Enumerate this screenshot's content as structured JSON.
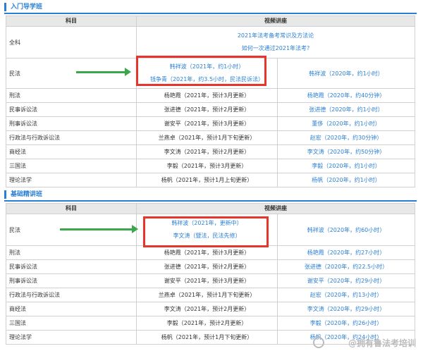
{
  "sections": [
    {
      "title": "入门导学班",
      "headers": {
        "subject": "科目",
        "video": "视频讲座"
      },
      "quanke": {
        "subject": "全科",
        "line1": "2021年法考备考常识及方法论",
        "line2": "如何一次通过2021年法考?"
      },
      "minfa": {
        "subject": "民法",
        "c1": "韩祥波（2021年，约1小时）",
        "c2": "钱争青（2021年，约3.5小时，民法民诉法）",
        "right": "韩祥波（2020年，约1小时）"
      },
      "rows": [
        {
          "subject": "刑法",
          "mid": "杨艳霞（2021年，预计3月更新）",
          "right": "杨艳霞（2020年，约40分钟）"
        },
        {
          "subject": "民事诉讼法",
          "mid": "张进德（2021年，预计2月更新）",
          "right": "张进德（2020年，约1小时）"
        },
        {
          "subject": "刑事诉讼法",
          "mid": "谢安平（2021年，预计3月更新）",
          "right": "董侈（2020年，约1小时）"
        },
        {
          "subject": "行政法与行政诉讼法",
          "mid": "兰燕卓（2021年，预计1月下旬更新）",
          "right": "赵宏（2020年，约30分钟）"
        },
        {
          "subject": "商经法",
          "mid": "李文涛（2021年，预计2月更新）",
          "right": "李文涛（2020年，约50分钟）"
        },
        {
          "subject": "三国法",
          "mid": "李毅（2021年，预计3月更新）",
          "right": "李毅（2020年，约1小时）"
        },
        {
          "subject": "理论法学",
          "mid": "杨帆（2021年，预计1月上旬更新）",
          "right": "杨帆（2020年，约1小时）"
        }
      ]
    },
    {
      "title": "基础精讲班",
      "headers": {
        "subject": "科目",
        "video": "视频讲座"
      },
      "minfa": {
        "subject": "民法",
        "c1": "韩祥波（2021年，更新中）",
        "c2": "李文涛（暨法，民法先修）",
        "right": "韩祥波（2020年，约60小时）"
      },
      "rows": [
        {
          "subject": "刑法",
          "mid": "杨艳霞（2021年，预计3月更新）",
          "right": "杨艳霞（2020年，约27小时）"
        },
        {
          "subject": "民事诉讼法",
          "mid": "张进德（2021年，预计2月更新）",
          "right": "张进德（2020年，约22.5小时）"
        },
        {
          "subject": "刑事诉讼法",
          "mid": "谢安平（2021年，预计3月更新）",
          "right": "谢安平（2020年，约29小时）"
        },
        {
          "subject": "行政法与行政诉讼法",
          "mid": "兰燕卓（2021年，预计1月下旬更新）",
          "right": "赵宏（2020年，约13小时）"
        },
        {
          "subject": "商经法",
          "mid": "李文涛（2021年，预计2月更新）",
          "right": "李文涛（2020年，约29小时）"
        },
        {
          "subject": "三国法",
          "mid": "李毅（2021年，预计2月更新）",
          "right": "李毅（2020年，约26小时）"
        },
        {
          "subject": "理论法学",
          "mid": "杨帆（2021年，预计1月下旬更新）",
          "right": "杨帆（2020年，约24小时）"
        }
      ]
    }
  ],
  "watermark": "@拥有鲁法考培训"
}
